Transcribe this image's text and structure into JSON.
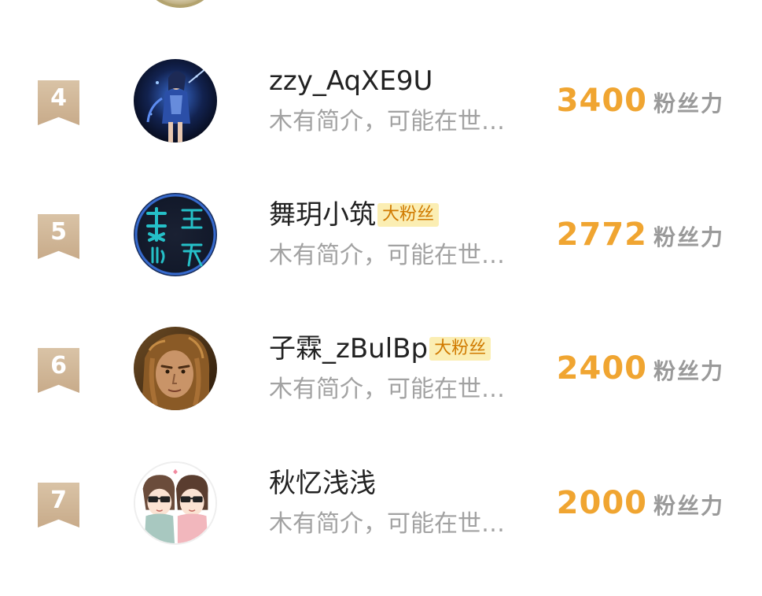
{
  "ranking": {
    "entries": [
      {
        "rank": "4",
        "name": "zzy_AqXE9U",
        "badge": "",
        "bio": "木有简介，可能在世…",
        "score": "3400",
        "score_unit": "粉丝力",
        "avatar_icon": "fantasy-warrior-woman-avatar"
      },
      {
        "rank": "5",
        "name": "舞玥小筑",
        "badge": "大粉丝",
        "bio": "木有简介，可能在世…",
        "score": "2772",
        "score_unit": "粉丝力",
        "avatar_icon": "calligraphy-text-avatar"
      },
      {
        "rank": "6",
        "name": "子霖_zBulBp",
        "badge": "大粉丝",
        "bio": "木有简介，可能在世…",
        "score": "2400",
        "score_unit": "粉丝力",
        "avatar_icon": "long-hair-man-portrait-avatar"
      },
      {
        "rank": "7",
        "name": "秋忆浅浅",
        "badge": "",
        "bio": "木有简介，可能在世…",
        "score": "2000",
        "score_unit": "粉丝力",
        "avatar_icon": "cartoon-couple-sunglasses-avatar"
      }
    ]
  },
  "colors": {
    "rank_badge": "#cdb393",
    "score": "#f0a531",
    "badge_bg": "#fbeeb3",
    "badge_text": "#d07a00",
    "bio": "#a2a2a2"
  }
}
